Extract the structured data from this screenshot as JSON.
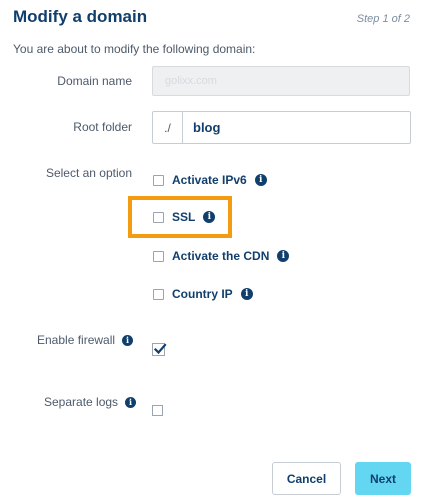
{
  "header": {
    "title": "Modify a domain",
    "step": "Step 1 of 2",
    "intro": "You are about to modify the following domain:"
  },
  "form": {
    "domain_name_label": "Domain name",
    "domain_name_value": "golixx.com",
    "root_folder_label": "Root folder",
    "root_folder_prefix": "./",
    "root_folder_value": "blog",
    "select_option_label": "Select an option",
    "options": [
      {
        "label": "Activate IPv6",
        "checked": false
      },
      {
        "label": "SSL",
        "checked": false,
        "highlighted": true
      },
      {
        "label": "Activate the CDN",
        "checked": false
      },
      {
        "label": "Country IP",
        "checked": false
      }
    ],
    "enable_firewall_label": "Enable firewall",
    "enable_firewall_checked": true,
    "separate_logs_label": "Separate logs",
    "separate_logs_checked": false
  },
  "icons": {
    "info": "info-icon",
    "check": "checkmark-icon"
  },
  "colors": {
    "title": "#113f6d",
    "highlight": "#f39c12",
    "primary_button": "#63d7f2"
  },
  "buttons": {
    "cancel": "Cancel",
    "next": "Next"
  }
}
